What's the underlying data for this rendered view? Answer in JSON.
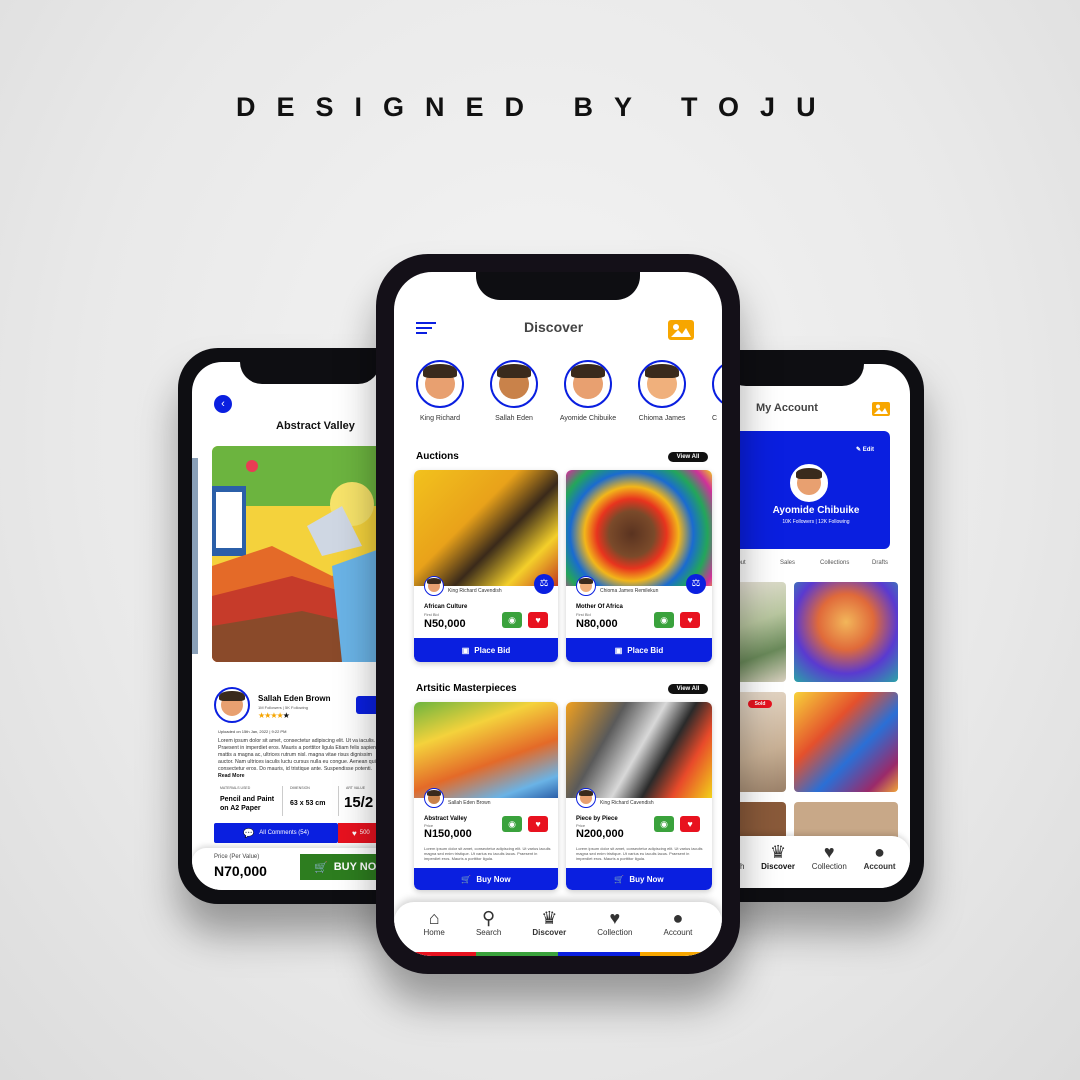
{
  "headline": "DESIGNED BY TOJU",
  "left_screen": {
    "title": "Abstract Valley",
    "artist_name": "Sallah Eden Brown",
    "artist_stats": "1M Followers | 5K Following",
    "upload_date": "Uploaded on 15th Jan, 2022 | 9:22 PM",
    "description": "Lorem ipsum dolor sit amet, consectetur adipiscing elit. Ut va iaculis. Praesent in imperdiet eros. Mauris a porttitor ligula Etiam felis sapien, mattis a magna ac, ultrices rutrum nisl. magna vitae risus dignissim auctor. Nam ultrices iaculis luctu cursus nulla eu congue. Aenean quis consectetur eros. Do mauris, id tristique ante. Suspendisse potenti.",
    "read_more": "Read More",
    "materials_label": "MATERIALS USED",
    "materials_value": "Pencil and Paint on A2 Paper",
    "dimension_label": "DIMENSION",
    "dimension_value": "63 x 53 cm",
    "art_value_label": "ART VALUE",
    "art_value_value": "15/2",
    "comments_label": "All Comments (54)",
    "likes_label": "500",
    "price_label": "Price (Per Value)",
    "price_value": "N70,000",
    "buy_label": "BUY NO"
  },
  "center_screen": {
    "title": "Discover",
    "artists": [
      {
        "name": "King Richard"
      },
      {
        "name": "Sallah Eden"
      },
      {
        "name": "Ayomide Chibuike"
      },
      {
        "name": "Chioma James"
      },
      {
        "name": "C"
      }
    ],
    "auctions": {
      "heading": "Auctions",
      "view_all": "View All",
      "cards": [
        {
          "artist": "King Richard Cavendish",
          "title": "African Culture",
          "sub": "First Bid",
          "price": "N50,000",
          "button": "Place Bid"
        },
        {
          "artist": "Chioma James Remilekun",
          "title": "Mother Of Africa",
          "sub": "First Bid",
          "price": "N80,000",
          "button": "Place Bid"
        }
      ]
    },
    "masterpieces": {
      "heading": "Artsitic Masterpieces",
      "view_all": "View All",
      "cards": [
        {
          "artist": "Sallah Eden Brown",
          "title": "Abstract Valley",
          "sub": "Price",
          "price": "N150,000",
          "desc": "Lorem ipsum dolor sit amet, consectetur adipiscing elit. Ut varius iaculis magna sed enim tristique. Ut varius eu iaculis lacus. Praesent in imperdiet eros. Mauris a porttitor ligula.",
          "button": "Buy Now"
        },
        {
          "artist": "King Richard Cavendish",
          "title": "Piece by Piece",
          "sub": "Price",
          "price": "N200,000",
          "desc": "Lorem ipsum dolor sit amet, consectetur adipiscing elit. Ut varius iaculis magna sed enim tristique. Ut varius eu iaculis lacus. Praesent in imperdiet eros. Mauris a porttitor ligula.",
          "button": "Buy Now"
        }
      ]
    },
    "nav": [
      {
        "label": "Home",
        "icon": "home-icon"
      },
      {
        "label": "Search",
        "icon": "search-icon"
      },
      {
        "label": "Discover",
        "icon": "crown-icon"
      },
      {
        "label": "Collection",
        "icon": "heart-icon"
      },
      {
        "label": "Account",
        "icon": "user-icon"
      }
    ]
  },
  "right_screen": {
    "title": "My Account",
    "edit_label": "Edit",
    "user_name": "Ayomide Chibuike",
    "user_stats": "10K Followers | 12K Following",
    "tabs": [
      "bout",
      "Sales",
      "Collections",
      "Drafts"
    ],
    "sold_badge": "Sold",
    "nav": [
      {
        "label": "earch",
        "icon": "search-icon"
      },
      {
        "label": "Discover",
        "icon": "crown-icon"
      },
      {
        "label": "Collection",
        "icon": "heart-icon"
      },
      {
        "label": "Account",
        "icon": "user-icon"
      }
    ]
  },
  "colors": {
    "accent_blue": "#0a1fe0",
    "accent_orange": "#f7a600",
    "like_red": "#e8121f",
    "view_green": "#3aa23c",
    "buy_green": "#2d7d1f"
  }
}
